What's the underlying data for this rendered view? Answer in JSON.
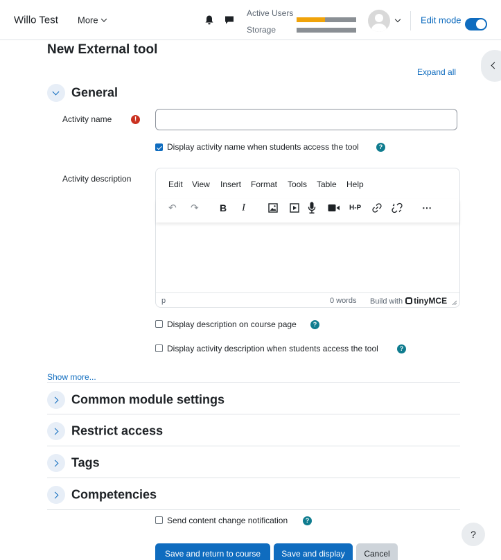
{
  "navbar": {
    "brand": "Willo Test",
    "more_label": "More",
    "active_users_label": "Active Users",
    "active_users_fill": 0.48,
    "storage_label": "Storage",
    "storage_fill": 0.0,
    "edit_mode_label": "Edit mode",
    "edit_mode_on": true
  },
  "page": {
    "title": "New External tool",
    "expand_all": "Expand all"
  },
  "general": {
    "title": "General",
    "activity_name_label": "Activity name",
    "activity_name_value": "",
    "required_symbol": "!",
    "display_name_label": "Display activity name when students access the tool",
    "activity_description_label": "Activity description",
    "display_desc_course_label": "Display description on course page",
    "display_desc_tool_label": "Display activity description when students access the tool"
  },
  "editor": {
    "menu": [
      "Edit",
      "View",
      "Insert",
      "Format",
      "Tools",
      "Table",
      "Help"
    ],
    "toolbar_icons": [
      "undo-icon",
      "redo-icon",
      "bold-icon",
      "italic-icon",
      "image-icon",
      "media-icon",
      "record-audio-icon",
      "record-video-icon",
      "h5p-icon",
      "link-icon",
      "unlink-icon",
      "more-icon"
    ],
    "toolbar_glyphs": {
      "undo": "↶",
      "redo": "↷",
      "bold": "B",
      "italic": "I",
      "h5p": "H-P",
      "link": "🔗",
      "unlink": "⛓",
      "more": "⋯"
    },
    "status_element": "p",
    "word_count": "0 words",
    "build_with": "Build with",
    "brand": "tinyMCE"
  },
  "show_more": "Show more...",
  "sections": [
    {
      "title": "Common module settings"
    },
    {
      "title": "Restrict access"
    },
    {
      "title": "Tags"
    },
    {
      "title": "Competencies"
    }
  ],
  "send_notification_label": "Send content change notification",
  "help_symbol": "?",
  "buttons": {
    "save_return": "Save and return to course",
    "save_display": "Save and display",
    "cancel": "Cancel"
  },
  "colors": {
    "primary": "#0f6cbf",
    "required": "#ca3120",
    "help": "#0f7c8f",
    "usage_fill": "#f0a30a"
  }
}
